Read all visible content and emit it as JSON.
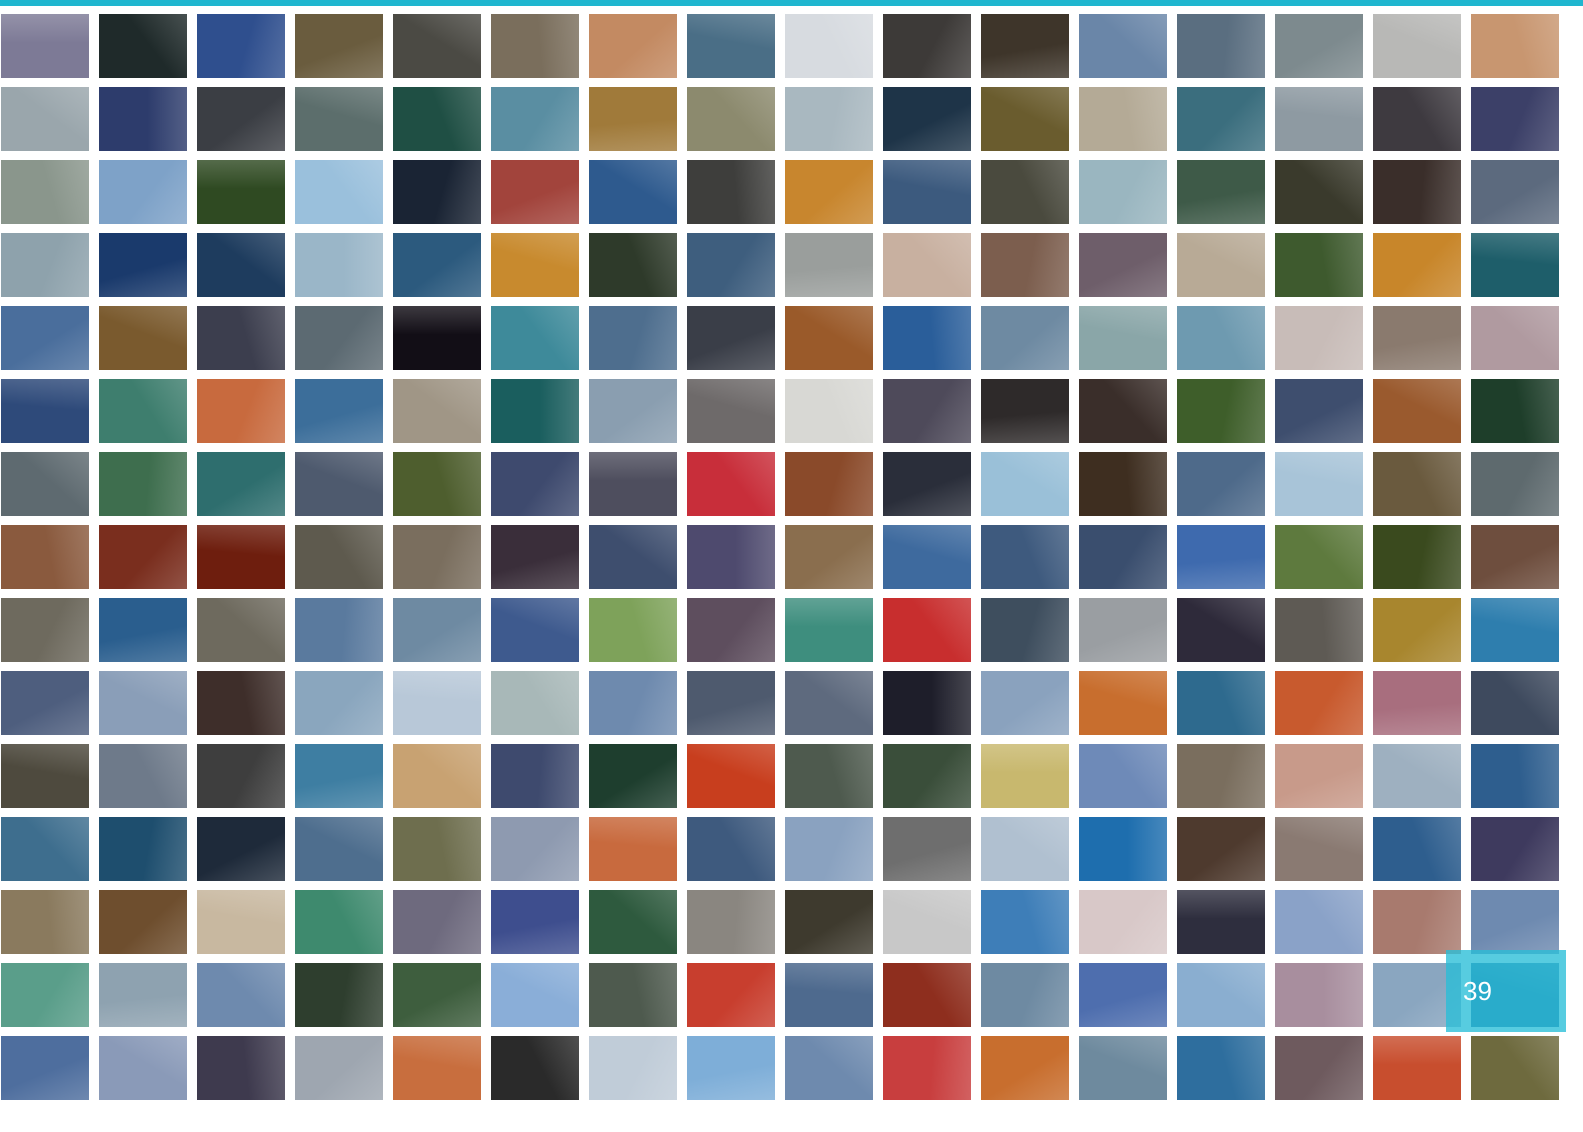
{
  "page": {
    "number": "39"
  },
  "colors": {
    "accent": "#1fb6cf",
    "badge": "#28bed7",
    "tiles": [
      [
        "#7d7a96",
        "#1f2a2a",
        "#2f4f8e",
        "#6a5c3e",
        "#4b4a44",
        "#7a6e5c",
        "#c38a62",
        "#4a6e86",
        "#d7dbe0",
        "#3d3a38",
        "#3e352a",
        "#6a86a8",
        "#5a6e80",
        "#7d8a8e",
        "#b8b8b6",
        "#c89670"
      ],
      [
        "#9aa6ac",
        "#2d3c6c",
        "#3b3e44",
        "#5c6e6c",
        "#1f4f44",
        "#5a8ea2",
        "#a07a3a",
        "#8c8a6e",
        "#a9b8c0",
        "#1e3448",
        "#6a5c2e",
        "#b4aa96",
        "#3b6e7e",
        "#8e9aa2",
        "#3e3a40",
        "#3c4068"
      ],
      [
        "#8a968c",
        "#7ea2c8",
        "#2f4a22",
        "#9ac0dc",
        "#1a2434",
        "#a2443c",
        "#2e5a8e",
        "#3e3e3c",
        "#c8862e",
        "#3c5a7e",
        "#4a4a3e",
        "#9ab6c0",
        "#3e5a48",
        "#3a3a2c",
        "#3a2e2a",
        "#5c6a7e"
      ],
      [
        "#8ea2ac",
        "#1a3a6c",
        "#1e3c5e",
        "#9ab6c8",
        "#2c5a7e",
        "#c88a2e",
        "#2e3a2a",
        "#3e5e7e",
        "#9a9e9c",
        "#c8b0a0",
        "#7c5e4e",
        "#6e5e6a",
        "#b8aa96",
        "#3e5a2e",
        "#c8862a",
        "#1e5e6a"
      ],
      [
        "#4a6e9c",
        "#7a5a2e",
        "#3c3e4e",
        "#5c6a72",
        "#120e16",
        "#3e8a9a",
        "#4e6e8e",
        "#3a3e48",
        "#9a5a2a",
        "#2a5e9a",
        "#6e8aa2",
        "#8aa6a8",
        "#6e9ab0",
        "#c8bcb8",
        "#8a7a6e",
        "#b09aa0"
      ],
      [
        "#2e4a7a",
        "#3e7e6e",
        "#c86a3e",
        "#3c6e9a",
        "#a09686",
        "#1a5e5e",
        "#8a9eb0",
        "#6e6a6a",
        "#d8d8d4",
        "#4e4a5a",
        "#2e2a2a",
        "#3a2e2a",
        "#3e5e2a",
        "#3e4e6e",
        "#9a5a2e",
        "#1e3e2a"
      ],
      [
        "#5e6a70",
        "#3e6e4e",
        "#2e6e6e",
        "#4e5a6e",
        "#4e5e2e",
        "#3e4a6e",
        "#4e4e5e",
        "#c82e3a",
        "#8a4a2a",
        "#2a2e3a",
        "#9ac0d8",
        "#3e2e20",
        "#4e6a8a",
        "#a8c4d8",
        "#6a5a3e",
        "#5e6a6e"
      ],
      [
        "#8a5a3e",
        "#7a2e1e",
        "#6e1e0e",
        "#5e5a4e",
        "#7a6e5e",
        "#3a2e3a",
        "#3e4e6e",
        "#4e4a6e",
        "#8a6e4e",
        "#3e6a9e",
        "#3e5a7e",
        "#3a4e6e",
        "#3e6aae",
        "#5e7a3e",
        "#3a4a1e",
        "#6e4e3e"
      ],
      [
        "#6e6a5e",
        "#2a5e8e",
        "#6e6a5e",
        "#5a7a9e",
        "#6e8aa2",
        "#3e5a8e",
        "#7ea25a",
        "#5e4e5e",
        "#3e8e7e",
        "#c82e2e",
        "#3e4e5e",
        "#9a9ea2",
        "#2e2a3a",
        "#5e5a54",
        "#a8862e",
        "#2e7eae"
      ],
      [
        "#4e5e7e",
        "#8a9eb8",
        "#3e2e2a",
        "#8aa6be",
        "#b8c8d8",
        "#a8b8b8",
        "#6e8aae",
        "#4e5a6e",
        "#5e6a7e",
        "#1e1e2a",
        "#8aa2be",
        "#c86e2e",
        "#2e6a8e",
        "#c85a2e",
        "#a86e7e",
        "#3e4a5e"
      ],
      [
        "#4e4a3e",
        "#6e7a8a",
        "#3e3e3e",
        "#3e7ea2",
        "#c8a272",
        "#3e4a6e",
        "#1e3e2e",
        "#c83e1e",
        "#4e5a4e",
        "#3a4e3a",
        "#c8b86e",
        "#6e8ab8",
        "#7a6e5e",
        "#c89a8a",
        "#9eb0c0",
        "#2e5e8e"
      ],
      [
        "#3e6e8e",
        "#1e4e6e",
        "#1e2a3a",
        "#4e6e8e",
        "#6e6e4e",
        "#8e9ab0",
        "#c86a3e",
        "#3e5a7e",
        "#8aa2c0",
        "#6e6e6e",
        "#b0c0d0",
        "#1e6eae",
        "#4e3a2e",
        "#8a7a72",
        "#2e5e8e",
        "#3e3a5e"
      ],
      [
        "#8a7a5e",
        "#6e4e2e",
        "#c8b8a0",
        "#3e8a6e",
        "#6e6a7e",
        "#3e4e8e",
        "#2e5a3e",
        "#8a8680",
        "#3e3a2e",
        "#c8c8c8",
        "#3e7eb8",
        "#d8c8c8",
        "#2e2e3e",
        "#8aa2c8",
        "#a87a6e",
        "#6e8ab0"
      ],
      [
        "#5a9e8a",
        "#8ea2b0",
        "#6e8aae",
        "#2e3e2e",
        "#3e5e3e",
        "#8aaed8",
        "#4e5a4e",
        "#c83e2e",
        "#4e6a8e",
        "#8e2e1e",
        "#6e8aa2",
        "#4e6eae",
        "#8aaed0",
        "#a88e9e",
        "#8aa6c0",
        "#2e6e9e"
      ],
      [
        "#4e6e9e",
        "#8a9ab8",
        "#3e3a4e",
        "#9ea6b0",
        "#c86e3e",
        "#2a2a2a",
        "#c0ccd8",
        "#7eaed8",
        "#6e8aae",
        "#c83e3e",
        "#c86e2e",
        "#6e8a9e",
        "#2e6e9e",
        "#6e5a5e",
        "#c84e2e",
        "#6e6a3e"
      ]
    ]
  }
}
